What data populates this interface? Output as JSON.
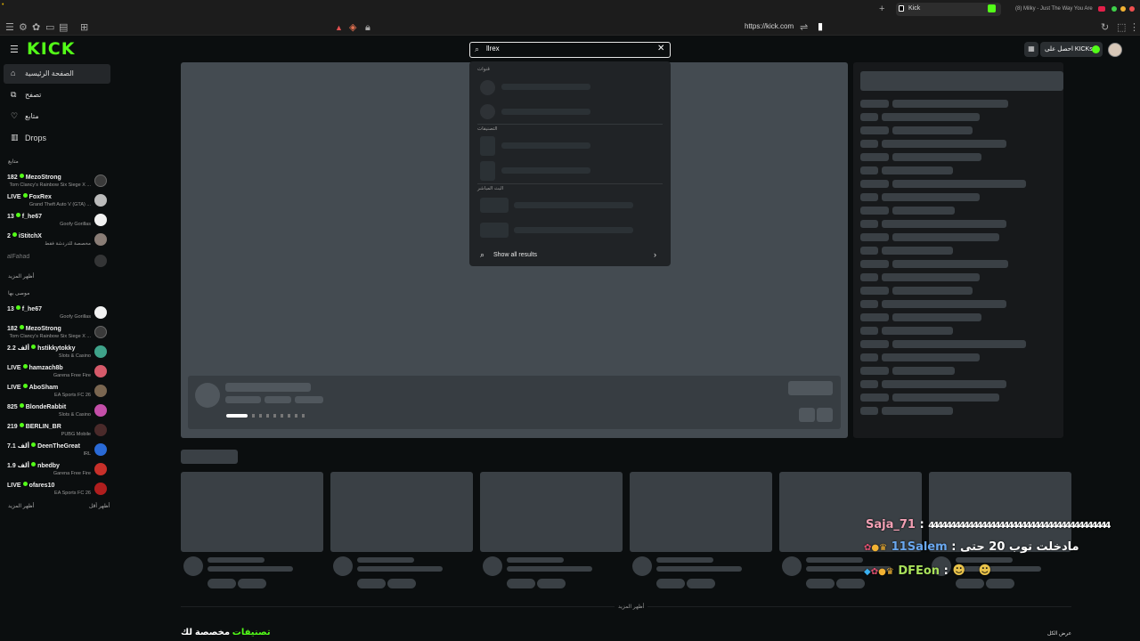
{
  "browser": {
    "tabs": [
      {
        "title": "Kick",
        "active": true
      },
      {
        "title": "(8) Milky - Just The Way You Are",
        "active": false
      }
    ],
    "url": "https://kick.com"
  },
  "header": {
    "logo": "KICK",
    "search": {
      "value": "llrex"
    },
    "get_kicks_label": "احصل على KICKs"
  },
  "sidebar": {
    "nav": [
      {
        "label": "الصفحة الرئيسية",
        "icon": "home-icon",
        "active": true
      },
      {
        "label": "تصفح",
        "icon": "browse-icon",
        "active": false
      },
      {
        "label": "متابع",
        "icon": "heart-icon",
        "active": false
      },
      {
        "label": "Drops",
        "icon": "drops-icon",
        "active": false
      }
    ],
    "following_title": "متابع",
    "following": [
      {
        "viewers": "182",
        "name": "MezoStrong",
        "category": "Tom Clancy's Rainbow Six Siege X ...",
        "avatar_color": "#3a3a3a"
      },
      {
        "viewers": "LIVE",
        "name": "FoxRex",
        "category": "Grand Theft Auto V (GTA) ...",
        "avatar_color": "#bbbbbb"
      },
      {
        "viewers": "13",
        "name": "f_he67",
        "category": "Goofy Gorillas",
        "avatar_color": "#f2f2f2"
      },
      {
        "viewers": "2",
        "name": "iStitchX",
        "category": "مخصصة للدردشة فقط",
        "avatar_color": "#8a7d76"
      },
      {
        "viewers": "",
        "name": "alFahad",
        "category": "",
        "avatar_color": "#666666"
      }
    ],
    "show_more_1": "أظهر المزيد",
    "recommended_title": "موصى بها",
    "recommended": [
      {
        "viewers": "13",
        "name": "f_he67",
        "category": "Goofy Gorillas",
        "avatar_color": "#f2f2f2"
      },
      {
        "viewers": "182",
        "name": "MezoStrong",
        "category": "Tom Clancy's Rainbow Six Siege X ...",
        "avatar_color": "#3a3a3a"
      },
      {
        "viewers": "2.2 ألف",
        "name": "hstikkytokky",
        "category": "Slots & Casino",
        "avatar_color": "#3fa38a"
      },
      {
        "viewers": "LIVE",
        "name": "hamzach8b",
        "category": "Garena Free Fire",
        "avatar_color": "#d65a6a"
      },
      {
        "viewers": "LIVE",
        "name": "AboSham",
        "category": "EA Sports FC 26",
        "avatar_color": "#7a6650"
      },
      {
        "viewers": "825",
        "name": "BlondeRabbit",
        "category": "Slots & Casino",
        "avatar_color": "#c44ea8"
      },
      {
        "viewers": "219",
        "name": "BERLIN_BR",
        "category": "PUBG Mobile",
        "avatar_color": "#4a2a2a"
      },
      {
        "viewers": "7.1 ألف",
        "name": "DeenTheGreat",
        "category": "IRL",
        "avatar_color": "#2a6ad6"
      },
      {
        "viewers": "1.9 ألف",
        "name": "nbedby",
        "category": "Garena Free Fire",
        "avatar_color": "#c8302a"
      },
      {
        "viewers": "LIVE",
        "name": "ofares10",
        "category": "EA Sports FC 26",
        "avatar_color": "#b01e1e"
      }
    ],
    "show_more_2": "أظهر المزيد",
    "show_less": "أظهر أقل"
  },
  "search_dropdown": {
    "sections": [
      "قنوات",
      "التصنيفات",
      "البث المباشر"
    ],
    "show_all_label": "Show all results"
  },
  "main": {
    "show_more_label": "أظهر المزيد",
    "categories_title_prefix": "تصنيفات",
    "categories_title_suffix": "مخصصة لك",
    "view_all_label": "عرض الكل"
  },
  "chat_overlay": [
    {
      "user": "Saja_71",
      "message": "44444444444444444444444444444444444444444"
    },
    {
      "user": "11Salem",
      "message": "مادخلت توب 20 حتى"
    },
    {
      "user": "DFEon",
      "message": ""
    }
  ],
  "colors": {
    "brand": "#53fc18",
    "bg": "#0b0e0f"
  }
}
